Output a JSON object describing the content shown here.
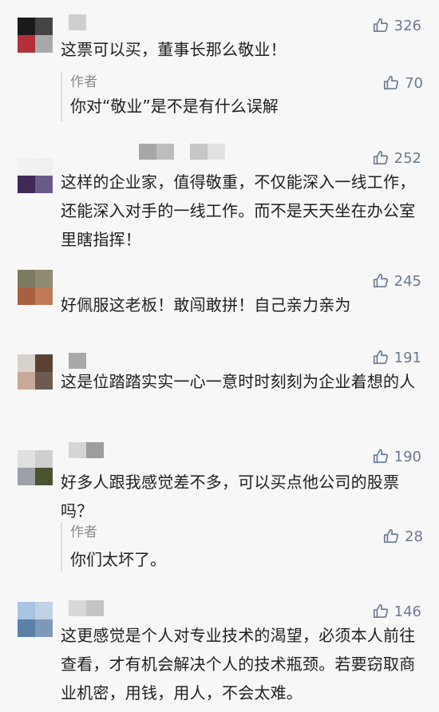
{
  "icon": "thumbs-up-icon",
  "colors": {
    "background": "#f7f7f7",
    "text": "#1f1f1f",
    "muted": "#8a8a8a",
    "like": "#6b7a90"
  },
  "comments": [
    {
      "likes": "326",
      "text": "这票可以买，董事长那么敬业！",
      "reply": {
        "author": "作者",
        "likes": "70",
        "text": "你对“敬业”是不是有什么误解"
      }
    },
    {
      "likes": "252",
      "text": "这样的企业家，值得敬重，不仅能深入一线工作，还能深入对手的一线工作。而不是天天坐在办公室里瞎指挥！"
    },
    {
      "likes": "245",
      "text": "好佩服这老板！敢闯敢拼！自己亲力亲为"
    },
    {
      "likes": "191",
      "text": "这是位踏踏实实一心一意时时刻刻为企业着想的人"
    },
    {
      "likes": "190",
      "text": "好多人跟我感觉差不多，可以买点他公司的股票吗？",
      "reply": {
        "author": "作者",
        "likes": "28",
        "text": "你们太坏了。"
      }
    },
    {
      "likes": "146",
      "text": "这更感觉是个人对专业技术的渴望，必须本人前往查看，才有机会解决个人的技术瓶颈。若要窃取商业机密，用钱，用人，不会太难。"
    }
  ]
}
